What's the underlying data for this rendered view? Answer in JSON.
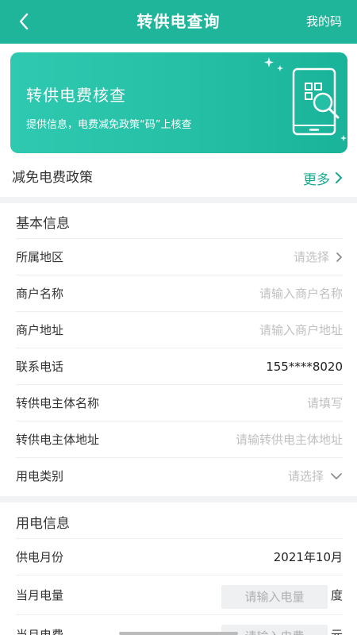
{
  "header": {
    "title": "转供电查询",
    "right_label": "我的码"
  },
  "banner": {
    "title": "转供电费核查",
    "subtitle": "提供信息，电费减免政策“码”上核查"
  },
  "policy": {
    "label": "减免电费政策",
    "more_label": "更多"
  },
  "basic_info": {
    "title": "基本信息",
    "region": {
      "label": "所属地区",
      "placeholder": "请选择"
    },
    "merchant_name": {
      "label": "商户名称",
      "placeholder": "请输入商户名称"
    },
    "merchant_address": {
      "label": "商户地址",
      "placeholder": "请输入商户地址"
    },
    "phone": {
      "label": "联系电话",
      "value": "155****8020"
    },
    "supplier_name": {
      "label": "转供电主体名称",
      "placeholder": "请填写"
    },
    "supplier_address": {
      "label": "转供电主体地址",
      "placeholder": "请输转供电主体地址"
    },
    "usage_type": {
      "label": "用电类别",
      "placeholder": "请选择"
    }
  },
  "usage_info": {
    "title": "用电信息",
    "month": {
      "label": "供电月份",
      "value": "2021年10月"
    },
    "kwh": {
      "label": "当月电量",
      "placeholder": "请输入电量",
      "unit": "度"
    },
    "fee": {
      "label": "当月电费",
      "placeholder": "请输入电费",
      "unit": "元"
    }
  },
  "colors": {
    "brand": "#1fb59b",
    "link": "#17a98f",
    "placeholder": "#c0c0c0"
  }
}
